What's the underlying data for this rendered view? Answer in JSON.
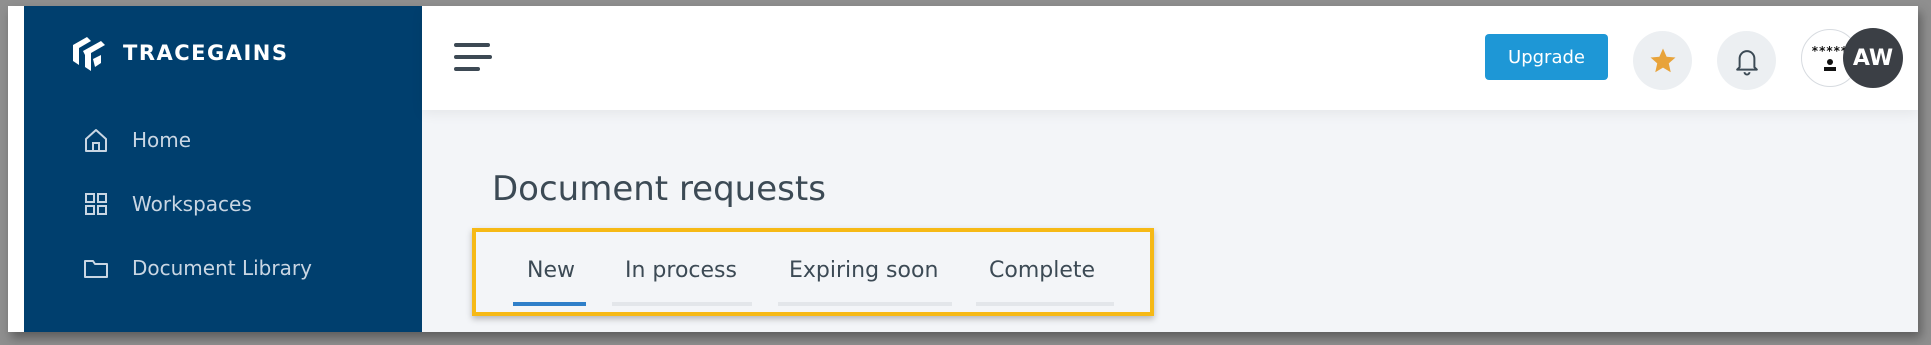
{
  "brand": {
    "name": "TRACEGAINS"
  },
  "sidebar": {
    "items": [
      {
        "label": "Home",
        "icon": "home-icon"
      },
      {
        "label": "Workspaces",
        "icon": "grid-icon"
      },
      {
        "label": "Document Library",
        "icon": "folder-icon"
      }
    ]
  },
  "header": {
    "upgrade_label": "Upgrade",
    "favorite_icon": "star-icon",
    "notification_icon": "bell-icon",
    "avatar_initials": "AW",
    "avatar_image_text": "*****"
  },
  "main": {
    "title": "Document requests",
    "tabs": [
      {
        "label": "New",
        "active": true
      },
      {
        "label": "In process",
        "active": false
      },
      {
        "label": "Expiring soon",
        "active": false
      },
      {
        "label": "Complete",
        "active": false
      }
    ]
  },
  "colors": {
    "sidebar_bg": "#003f6e",
    "accent": "#1e97d6",
    "active_tab": "#2f7fc9",
    "highlight_box": "#f6b916",
    "star": "#e8a33a"
  }
}
